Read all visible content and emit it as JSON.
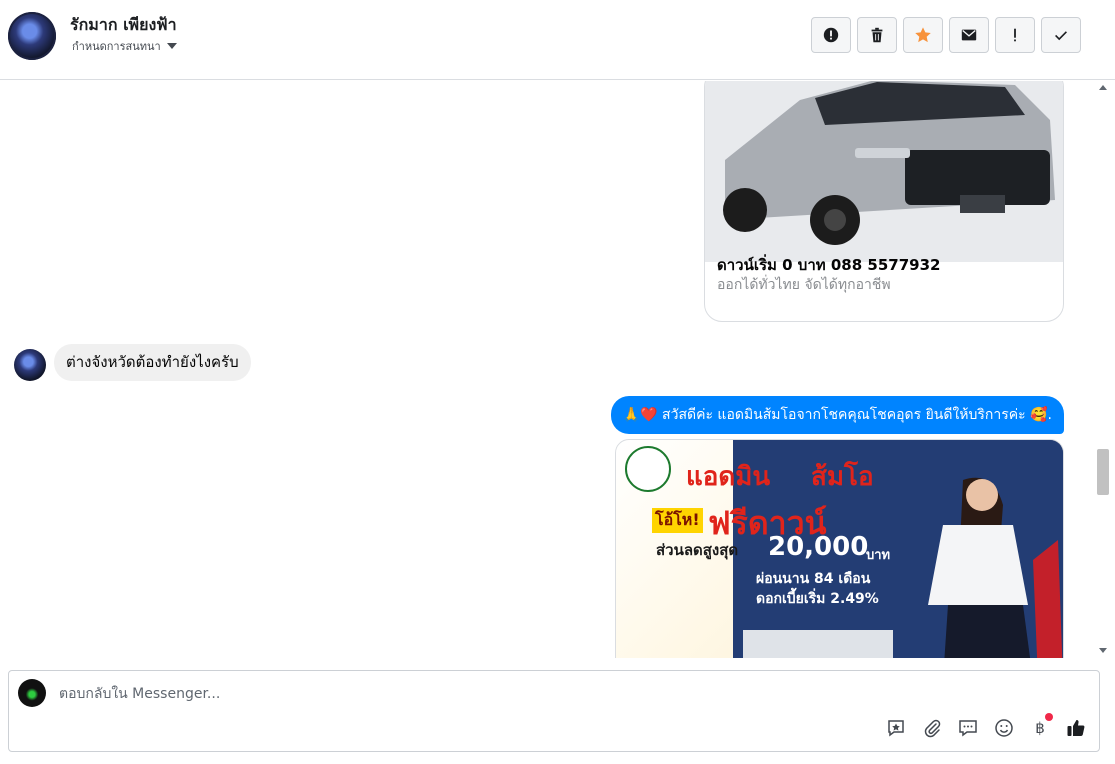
{
  "header": {
    "contact_name": "รักมาก เพียงฟ้า",
    "assign_label": "กำหนดการสนทนา",
    "toolbar": [
      {
        "icon": "alert-circle-icon",
        "name": "mark-spam-button"
      },
      {
        "icon": "trash-icon",
        "name": "delete-button"
      },
      {
        "icon": "star-icon",
        "name": "star-button",
        "color": "#f7923b"
      },
      {
        "icon": "envelope-icon",
        "name": "mark-unread-button"
      },
      {
        "icon": "exclamation-icon",
        "name": "follow-up-button"
      },
      {
        "icon": "check-icon",
        "name": "mark-done-button"
      }
    ]
  },
  "thread": {
    "card1": {
      "title": "ดาวน์เริ่ม 0 บาท 088 5577932",
      "subtitle": "ออกได้ทั่วไทย จัดได้ทุกอาชีพ"
    },
    "incoming_message": "ต่างจังหวัดต้องทำยังไงครับ",
    "outgoing_message": "🙏❤️ สวัสดีค่ะ แอดมินส้มโอจากโชคคุณโชคอุดร ยินดีให้บริการค่ะ 🥰.",
    "card2": {
      "line1_a": "แอดมิน",
      "line1_b": "ส้มโอ",
      "badge": "โอ้โห!",
      "free_down": "ฟรีดาวน์",
      "discount_label": "ส่วนลดสูงสุด",
      "discount_amount": "20,000",
      "discount_unit": "บาท",
      "months": "ผ่อนนาน 84 เดือน",
      "rate": "ดอกเบี้ยเริ่ม 2.49%"
    }
  },
  "composer": {
    "placeholder": "ตอบกลับใน Messenger...",
    "tools": [
      "saved-reply-icon",
      "paperclip-icon",
      "speech-bubble-icon",
      "smiley-icon",
      "baht-icon",
      "thumbs-up-icon"
    ],
    "baht_symbol": "฿"
  },
  "colors": {
    "messenger_blue": "#0084ff",
    "incoming_bubble": "#f0f0f0",
    "star": "#f7923b",
    "notification_dot": "#f02849"
  }
}
